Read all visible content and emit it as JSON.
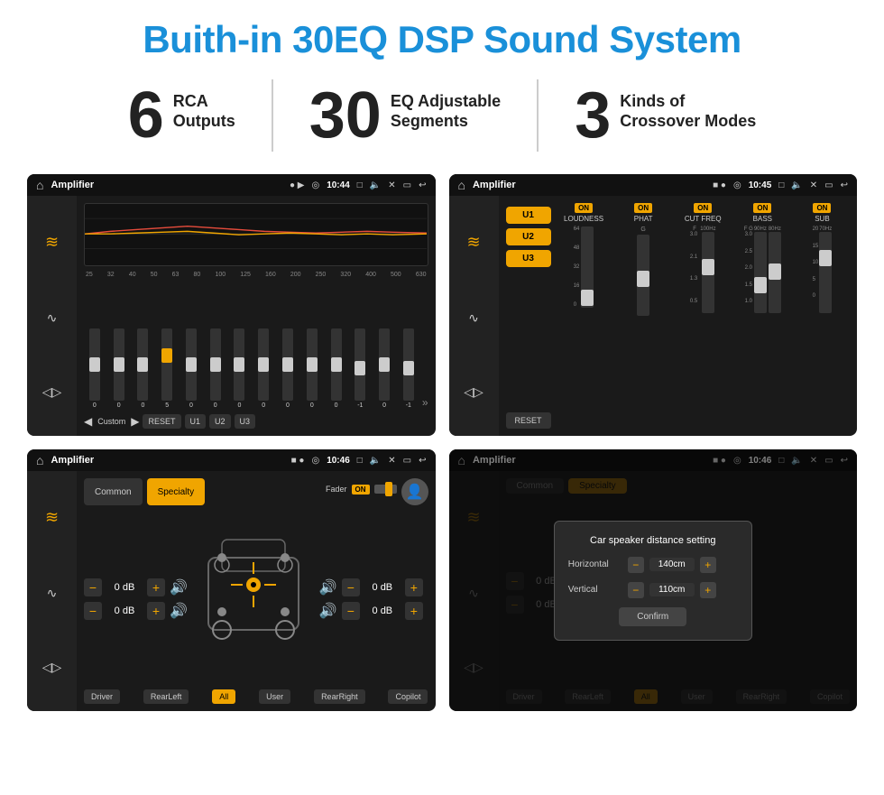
{
  "page": {
    "title": "Buith-in 30EQ DSP Sound System",
    "stats": [
      {
        "number": "6",
        "label_top": "RCA",
        "label_bottom": "Outputs"
      },
      {
        "number": "30",
        "label_top": "EQ Adjustable",
        "label_bottom": "Segments"
      },
      {
        "number": "3",
        "label_top": "Kinds of",
        "label_bottom": "Crossover Modes"
      }
    ]
  },
  "screens": {
    "screen1": {
      "title": "Amplifier",
      "time": "10:44",
      "bottom_btns": [
        "Custom",
        "RESET",
        "U1",
        "U2",
        "U3"
      ],
      "eq_freqs": [
        "25",
        "32",
        "40",
        "50",
        "63",
        "80",
        "100",
        "125",
        "160",
        "200",
        "250",
        "320",
        "400",
        "500",
        "630"
      ],
      "eq_values": [
        "0",
        "0",
        "0",
        "5",
        "0",
        "0",
        "0",
        "0",
        "0",
        "0",
        "0",
        "-1",
        "0",
        "-1"
      ]
    },
    "screen2": {
      "title": "Amplifier",
      "time": "10:45",
      "presets": [
        "U1",
        "U2",
        "U3"
      ],
      "channels": [
        "LOUDNESS",
        "PHAT",
        "CUT FREQ",
        "BASS",
        "SUB"
      ],
      "reset_label": "RESET"
    },
    "screen3": {
      "title": "Amplifier",
      "time": "10:46",
      "tabs": [
        "Common",
        "Specialty"
      ],
      "active_tab": "Specialty",
      "fader_label": "Fader",
      "fader_on": "ON",
      "controls": [
        {
          "value": "0 dB"
        },
        {
          "value": "0 dB"
        },
        {
          "value": "0 dB"
        },
        {
          "value": "0 dB"
        }
      ],
      "bottom_btns": [
        "Driver",
        "RearLeft",
        "All",
        "User",
        "RearRight",
        "Copilot"
      ]
    },
    "screen4": {
      "title": "Amplifier",
      "time": "10:46",
      "tabs": [
        "Common",
        "Specialty"
      ],
      "dialog": {
        "title": "Car speaker distance setting",
        "horizontal_label": "Horizontal",
        "horizontal_value": "140cm",
        "vertical_label": "Vertical",
        "vertical_value": "110cm",
        "confirm_label": "Confirm"
      },
      "bottom_btns": [
        "Driver",
        "RearLeft",
        "All",
        "User",
        "RearRight",
        "Copilot"
      ]
    }
  },
  "icons": {
    "home": "⌂",
    "equalizer": "≋",
    "waveform": "∿",
    "speaker": "🔊",
    "location": "◎",
    "camera": "📷",
    "volume": "🔈",
    "close": "✕",
    "back": "↺",
    "play": "▶",
    "pause": "⏸",
    "left_arrow": "◀",
    "right_arrow": "▶",
    "person": "👤",
    "expand": "⛶",
    "minus": "−",
    "plus": "+"
  }
}
